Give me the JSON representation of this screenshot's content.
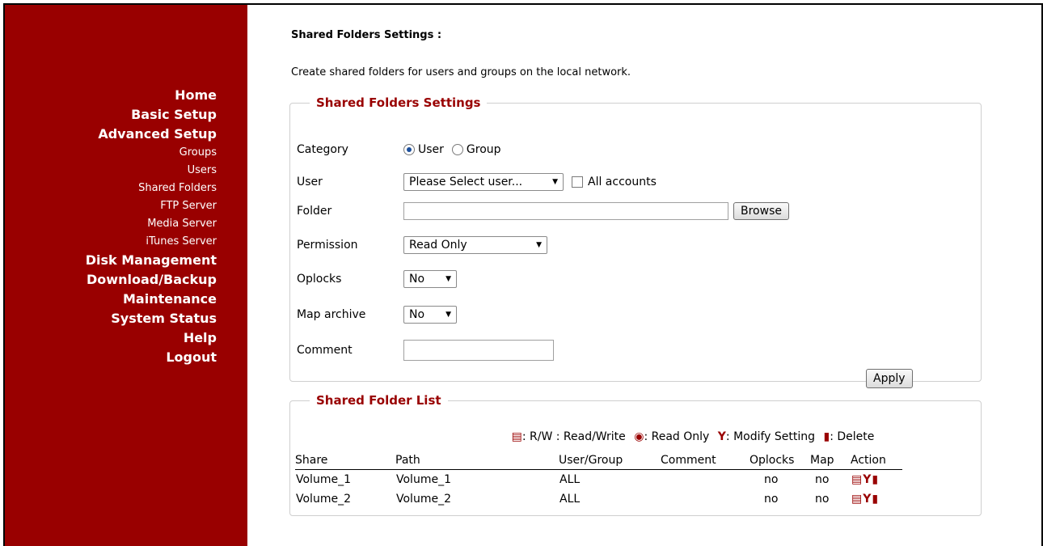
{
  "sidebar": {
    "items": [
      {
        "label": "Home",
        "type": "main"
      },
      {
        "label": "Basic Setup",
        "type": "main"
      },
      {
        "label": "Advanced Setup",
        "type": "main"
      },
      {
        "label": "Groups",
        "type": "sub"
      },
      {
        "label": "Users",
        "type": "sub"
      },
      {
        "label": "Shared Folders",
        "type": "sub"
      },
      {
        "label": "FTP Server",
        "type": "sub"
      },
      {
        "label": "Media Server",
        "type": "sub"
      },
      {
        "label": "iTunes Server",
        "type": "sub"
      },
      {
        "label": "Disk Management",
        "type": "main"
      },
      {
        "label": "Download/Backup",
        "type": "main"
      },
      {
        "label": "Maintenance",
        "type": "main"
      },
      {
        "label": "System Status",
        "type": "main"
      },
      {
        "label": "Help",
        "type": "main"
      },
      {
        "label": "Logout",
        "type": "main"
      }
    ]
  },
  "page": {
    "title": "Shared Folders Settings :",
    "intro": "Create shared folders for users and groups on the local network."
  },
  "settings": {
    "legend": "Shared Folders Settings",
    "category_label": "Category",
    "category_user": "User",
    "category_group": "Group",
    "user_label": "User",
    "user_select_value": "Please Select user...",
    "all_accounts_label": "All accounts",
    "folder_label": "Folder",
    "folder_value": "",
    "browse_label": "Browse",
    "permission_label": "Permission",
    "permission_value": "Read Only",
    "oplocks_label": "Oplocks",
    "oplocks_value": "No",
    "map_archive_label": "Map archive",
    "map_archive_value": "No",
    "comment_label": "Comment",
    "comment_value": "",
    "apply_label": "Apply"
  },
  "list": {
    "legend": "Shared Folder List",
    "legend_rw": ": R/W : Read/Write",
    "legend_ro": ": Read Only",
    "legend_modify": ": Modify Setting",
    "legend_delete": ": Delete",
    "headers": {
      "share": "Share",
      "path": "Path",
      "usergroup": "User/Group",
      "comment": "Comment",
      "oplocks": "Oplocks",
      "map": "Map",
      "action": "Action"
    },
    "rows": [
      {
        "share": "Volume_1",
        "path": "Volume_1",
        "usergroup": "ALL",
        "comment": "",
        "oplocks": "no",
        "map": "no"
      },
      {
        "share": "Volume_2",
        "path": "Volume_2",
        "usergroup": "ALL",
        "comment": "",
        "oplocks": "no",
        "map": "no"
      }
    ]
  },
  "colors": {
    "accent": "#990000",
    "select_dot": "#1c4f9c"
  }
}
